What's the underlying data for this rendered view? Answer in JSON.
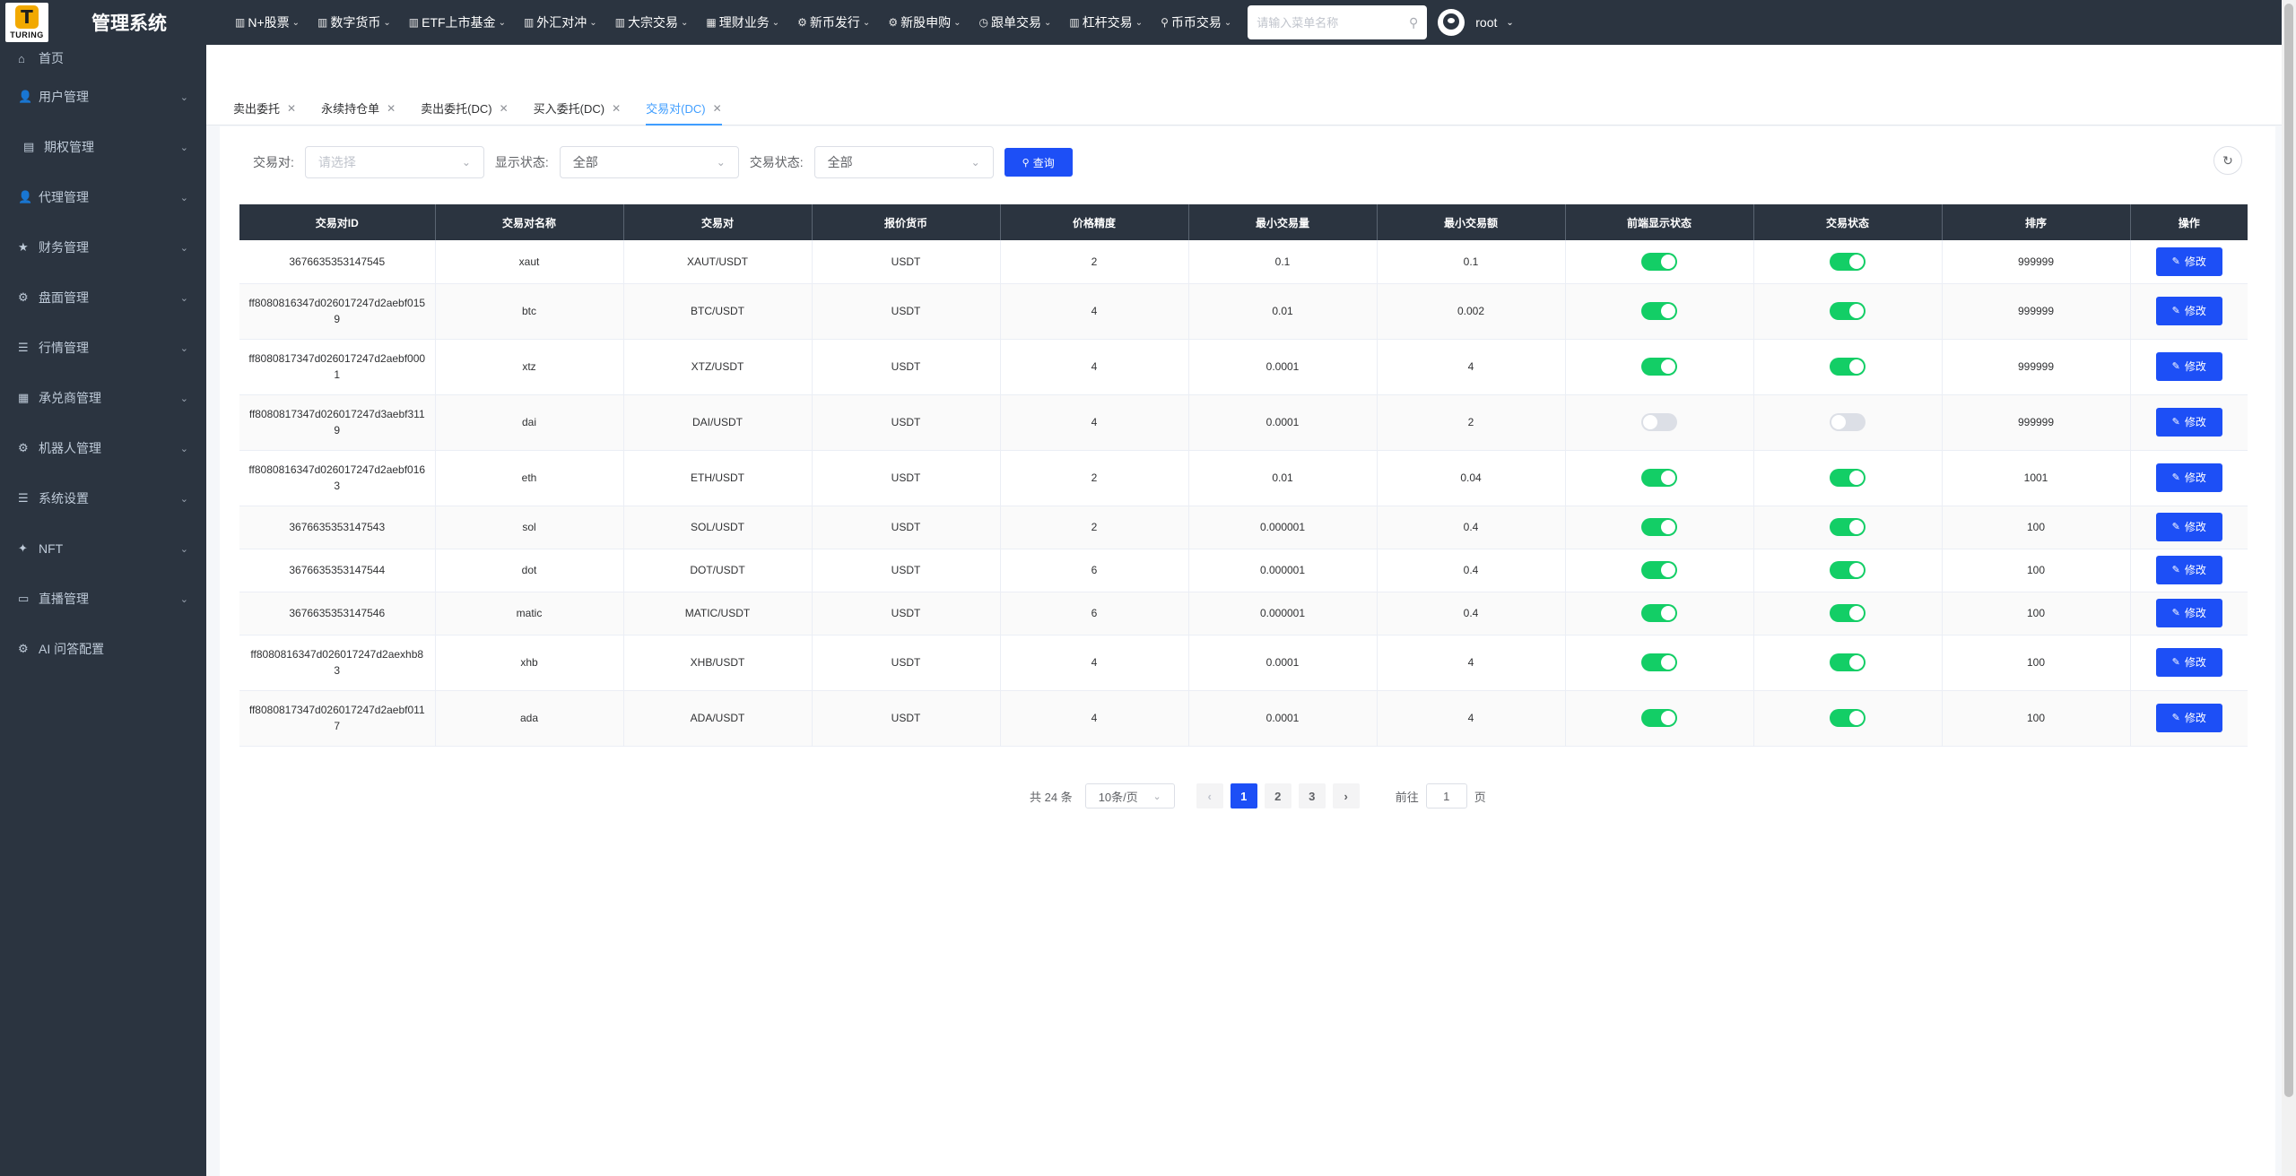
{
  "header": {
    "logo_text": "TURING",
    "logo_letter": "T",
    "title": "管理系统",
    "nav": [
      {
        "icon": "bar-chart-icon",
        "glyph": "▥",
        "label": "N+股票"
      },
      {
        "icon": "bar-chart-icon",
        "glyph": "▥",
        "label": "数字货币"
      },
      {
        "icon": "bar-chart-icon",
        "glyph": "▥",
        "label": "ETF上市基金"
      },
      {
        "icon": "bar-chart-icon",
        "glyph": "▥",
        "label": "外汇对冲"
      },
      {
        "icon": "bar-chart-icon",
        "glyph": "▥",
        "label": "大宗交易"
      },
      {
        "icon": "grid-icon",
        "glyph": "▦",
        "label": "理财业务"
      },
      {
        "icon": "gear-icon",
        "glyph": "⚙",
        "label": "新币发行"
      },
      {
        "icon": "gear-icon",
        "glyph": "⚙",
        "label": "新股申购"
      },
      {
        "icon": "clock-icon",
        "glyph": "◷",
        "label": "跟单交易"
      },
      {
        "icon": "bar-chart-icon",
        "glyph": "▥",
        "label": "杠杆交易"
      },
      {
        "icon": "location-icon",
        "glyph": "⚲",
        "label": "币币交易"
      }
    ],
    "search_placeholder": "请输入菜单名称",
    "username": "root"
  },
  "sidebar": {
    "items": [
      {
        "icon": "home-icon",
        "glyph": "⌂",
        "label": "首页",
        "expandable": false,
        "sub": false
      },
      {
        "icon": "user-icon",
        "glyph": "👤",
        "label": "用户管理",
        "expandable": true,
        "sub": false
      },
      {
        "icon": "document-icon",
        "glyph": "▤",
        "label": "期权管理",
        "expandable": true,
        "sub": true
      },
      {
        "icon": "user-icon",
        "glyph": "👤",
        "label": "代理管理",
        "expandable": true,
        "sub": false
      },
      {
        "icon": "star-icon",
        "glyph": "★",
        "label": "财务管理",
        "expandable": true,
        "sub": false
      },
      {
        "icon": "gear-icon",
        "glyph": "⚙",
        "label": "盘面管理",
        "expandable": true,
        "sub": false
      },
      {
        "icon": "list-icon",
        "glyph": "☰",
        "label": "行情管理",
        "expandable": true,
        "sub": false
      },
      {
        "icon": "table-icon",
        "glyph": "▦",
        "label": "承兑商管理",
        "expandable": true,
        "sub": false
      },
      {
        "icon": "gear-icon",
        "glyph": "⚙",
        "label": "机器人管理",
        "expandable": true,
        "sub": false
      },
      {
        "icon": "list-icon",
        "glyph": "☰",
        "label": "系统设置",
        "expandable": true,
        "sub": false
      },
      {
        "icon": "nft-icon",
        "glyph": "✦",
        "label": "NFT",
        "expandable": true,
        "sub": false
      },
      {
        "icon": "video-icon",
        "glyph": "▭",
        "label": "直播管理",
        "expandable": true,
        "sub": false
      },
      {
        "icon": "gear-icon",
        "glyph": "⚙",
        "label": "AI 问答配置",
        "expandable": false,
        "sub": false
      }
    ]
  },
  "tabs": [
    {
      "label": "卖出委托",
      "active": false
    },
    {
      "label": "永续持仓单",
      "active": false
    },
    {
      "label": "卖出委托(DC)",
      "active": false
    },
    {
      "label": "买入委托(DC)",
      "active": false
    },
    {
      "label": "交易对(DC)",
      "active": true
    }
  ],
  "filter": {
    "pair_label": "交易对:",
    "pair_placeholder": "请选择",
    "display_label": "显示状态:",
    "display_value": "全部",
    "trade_label": "交易状态:",
    "trade_value": "全部",
    "search_button": "查询"
  },
  "table": {
    "columns": [
      "交易对ID",
      "交易对名称",
      "交易对",
      "报价货币",
      "价格精度",
      "最小交易量",
      "最小交易额",
      "前端显示状态",
      "交易状态",
      "排序",
      "操作"
    ],
    "edit_label": "修改",
    "rows": [
      {
        "id": "3676635353147545",
        "name": "xaut",
        "pair": "XAUT/USDT",
        "quote": "USDT",
        "precision": "2",
        "min_qty": "0.1",
        "min_amount": "0.1",
        "display": true,
        "trade": true,
        "sort": "999999"
      },
      {
        "id": "ff8080816347d026017247d2aebf0159",
        "name": "btc",
        "pair": "BTC/USDT",
        "quote": "USDT",
        "precision": "4",
        "min_qty": "0.01",
        "min_amount": "0.002",
        "display": true,
        "trade": true,
        "sort": "999999"
      },
      {
        "id": "ff8080817347d026017247d2aebf0001",
        "name": "xtz",
        "pair": "XTZ/USDT",
        "quote": "USDT",
        "precision": "4",
        "min_qty": "0.0001",
        "min_amount": "4",
        "display": true,
        "trade": true,
        "sort": "999999"
      },
      {
        "id": "ff8080817347d026017247d3aebf3119",
        "name": "dai",
        "pair": "DAI/USDT",
        "quote": "USDT",
        "precision": "4",
        "min_qty": "0.0001",
        "min_amount": "2",
        "display": false,
        "trade": false,
        "sort": "999999"
      },
      {
        "id": "ff8080816347d026017247d2aebf0163",
        "name": "eth",
        "pair": "ETH/USDT",
        "quote": "USDT",
        "precision": "2",
        "min_qty": "0.01",
        "min_amount": "0.04",
        "display": true,
        "trade": true,
        "sort": "1001"
      },
      {
        "id": "3676635353147543",
        "name": "sol",
        "pair": "SOL/USDT",
        "quote": "USDT",
        "precision": "2",
        "min_qty": "0.000001",
        "min_amount": "0.4",
        "display": true,
        "trade": true,
        "sort": "100"
      },
      {
        "id": "3676635353147544",
        "name": "dot",
        "pair": "DOT/USDT",
        "quote": "USDT",
        "precision": "6",
        "min_qty": "0.000001",
        "min_amount": "0.4",
        "display": true,
        "trade": true,
        "sort": "100"
      },
      {
        "id": "3676635353147546",
        "name": "matic",
        "pair": "MATIC/USDT",
        "quote": "USDT",
        "precision": "6",
        "min_qty": "0.000001",
        "min_amount": "0.4",
        "display": true,
        "trade": true,
        "sort": "100"
      },
      {
        "id": "ff8080816347d026017247d2aexhb83",
        "name": "xhb",
        "pair": "XHB/USDT",
        "quote": "USDT",
        "precision": "4",
        "min_qty": "0.0001",
        "min_amount": "4",
        "display": true,
        "trade": true,
        "sort": "100"
      },
      {
        "id": "ff8080817347d026017247d2aebf0117",
        "name": "ada",
        "pair": "ADA/USDT",
        "quote": "USDT",
        "precision": "4",
        "min_qty": "0.0001",
        "min_amount": "4",
        "display": true,
        "trade": true,
        "sort": "100"
      }
    ]
  },
  "pagination": {
    "total": "共 24 条",
    "page_size": "10条/页",
    "prev": "‹",
    "next": "›",
    "pages": [
      "1",
      "2",
      "3"
    ],
    "current": "1",
    "goto_label": "前往",
    "goto_value": "1",
    "goto_suffix": "页"
  },
  "colors": {
    "sidebar_bg": "#2b3440",
    "primary": "#1d4ff6",
    "switch_on": "#13ce66",
    "switch_off": "#dcdfe6"
  }
}
